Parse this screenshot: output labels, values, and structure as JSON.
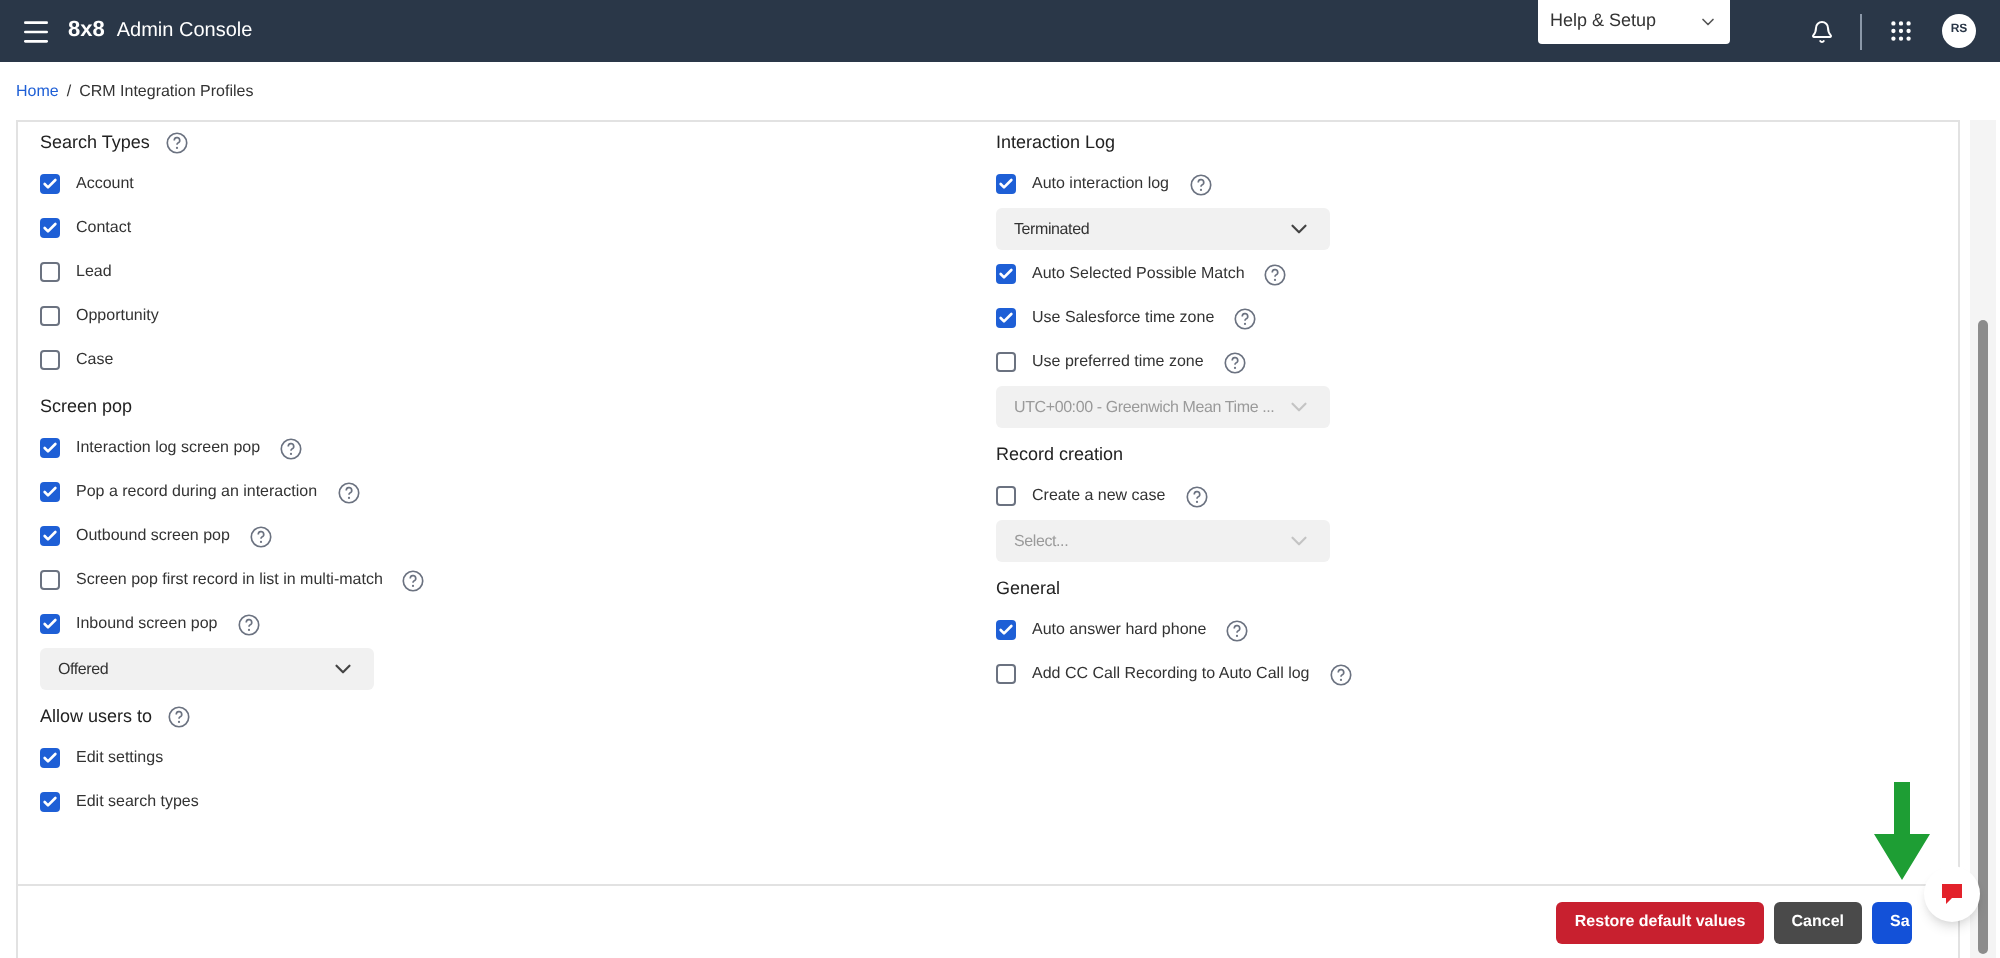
{
  "header": {
    "brand_mark": "8x8",
    "app_name": "Admin Console",
    "help_menu": "Help & Setup",
    "avatar": "RS"
  },
  "breadcrumb": [
    {
      "label": "Home",
      "kind": "link"
    },
    {
      "label": "/",
      "kind": "separator"
    },
    {
      "label": "CRM Integration Profiles",
      "kind": "current"
    }
  ],
  "columns": [
    [
      {
        "title": "Search Types",
        "help": true,
        "items": [
          {
            "kind": "checkbox",
            "label": "Account",
            "checked": true,
            "help": false
          },
          {
            "kind": "checkbox",
            "label": "Contact",
            "checked": true,
            "help": false
          },
          {
            "kind": "checkbox",
            "label": "Lead",
            "checked": false,
            "help": false
          },
          {
            "kind": "checkbox",
            "label": "Opportunity",
            "checked": false,
            "help": false
          },
          {
            "kind": "checkbox",
            "label": "Case",
            "checked": false,
            "help": false
          }
        ]
      },
      {
        "title": "Screen pop",
        "help": false,
        "items": [
          {
            "kind": "checkbox",
            "label": "Interaction log screen pop",
            "checked": true,
            "help": true
          },
          {
            "kind": "checkbox",
            "label": "Pop a record during an interaction",
            "checked": true,
            "help": true
          },
          {
            "kind": "checkbox",
            "label": "Outbound screen pop",
            "checked": true,
            "help": true
          },
          {
            "kind": "checkbox",
            "label": "Screen pop first record in list in multi-match",
            "checked": false,
            "help": true
          },
          {
            "kind": "checkbox",
            "label": "Inbound screen pop",
            "checked": true,
            "help": true
          },
          {
            "kind": "select",
            "value": "Offered",
            "disabled": false
          }
        ]
      },
      {
        "title": "Allow users to",
        "help": true,
        "items": [
          {
            "kind": "checkbox",
            "label": "Edit settings",
            "checked": true,
            "help": false
          },
          {
            "kind": "checkbox",
            "label": "Edit search types",
            "checked": true,
            "help": false
          }
        ]
      }
    ],
    [
      {
        "title": "Interaction Log",
        "help": false,
        "items": [
          {
            "kind": "checkbox",
            "label": "Auto interaction log",
            "checked": true,
            "help": true
          },
          {
            "kind": "select",
            "value": "Terminated",
            "disabled": false
          },
          {
            "kind": "checkbox",
            "label": "Auto Selected Possible Match",
            "checked": true,
            "help": true
          },
          {
            "kind": "checkbox",
            "label": "Use Salesforce time zone",
            "checked": true,
            "help": true
          },
          {
            "kind": "checkbox",
            "label": "Use preferred time zone",
            "checked": false,
            "help": true
          },
          {
            "kind": "select",
            "value": "UTC+00:00 - Greenwich Mean Time ...",
            "disabled": true
          }
        ]
      },
      {
        "title": "Record creation",
        "help": false,
        "items": [
          {
            "kind": "checkbox",
            "label": "Create a new case",
            "checked": false,
            "help": true
          },
          {
            "kind": "select",
            "placeholder": "Select...",
            "disabled": true
          }
        ]
      },
      {
        "title": "General",
        "help": false,
        "items": [
          {
            "kind": "checkbox",
            "label": "Auto answer hard phone",
            "checked": true,
            "help": true
          },
          {
            "kind": "checkbox",
            "label": "Add CC Call Recording to Auto Call log",
            "checked": false,
            "help": true
          }
        ]
      }
    ]
  ],
  "footer_buttons": [
    {
      "label": "Restore default values",
      "kind": "danger"
    },
    {
      "label": "Cancel",
      "kind": "neutral"
    },
    {
      "label": "Sa",
      "kind": "primary"
    }
  ]
}
